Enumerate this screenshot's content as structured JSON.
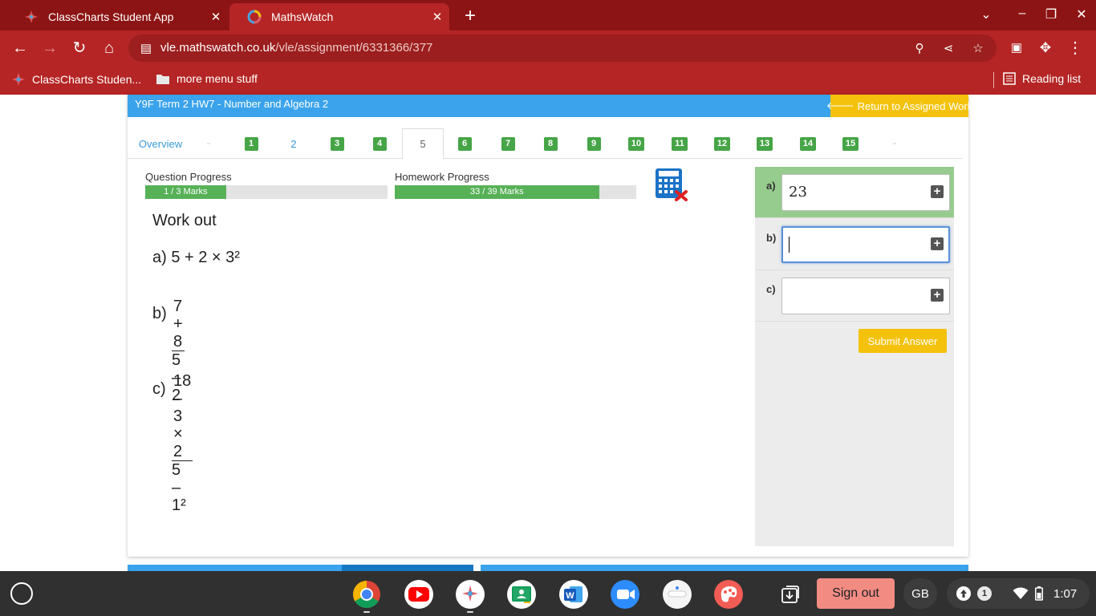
{
  "browser": {
    "tabs": [
      {
        "title": "ClassCharts Student App",
        "active": false
      },
      {
        "title": "MathsWatch",
        "active": true
      }
    ],
    "url": {
      "host": "vle.mathswatch.co.uk",
      "path": "/vle/assignment/6331366/377"
    },
    "bookmarks": [
      {
        "label": "ClassCharts Studen..."
      },
      {
        "label": "more menu stuff"
      }
    ],
    "reading_list": "Reading list"
  },
  "homework": {
    "title": "Y9F Term 2 HW7 - Number and Algebra 2",
    "return_label": "Return to Assigned Work",
    "tabs": [
      {
        "label": "Overview",
        "style": "link"
      },
      {
        "label": "1",
        "style": "chip"
      },
      {
        "label": "2",
        "style": "link"
      },
      {
        "label": "3",
        "style": "chip"
      },
      {
        "label": "4",
        "style": "chip"
      },
      {
        "label": "5",
        "style": "current"
      },
      {
        "label": "6",
        "style": "chip"
      },
      {
        "label": "7",
        "style": "chip"
      },
      {
        "label": "8",
        "style": "chip"
      },
      {
        "label": "9",
        "style": "chip"
      },
      {
        "label": "10",
        "style": "chip"
      },
      {
        "label": "11",
        "style": "chip"
      },
      {
        "label": "12",
        "style": "chip"
      },
      {
        "label": "13",
        "style": "chip"
      },
      {
        "label": "14",
        "style": "chip"
      },
      {
        "label": "15",
        "style": "chip"
      }
    ],
    "question_progress": {
      "label": "Question Progress",
      "text": "1 / 3 Marks",
      "fraction": 0.333
    },
    "homework_progress": {
      "label": "Homework Progress",
      "text": "33 / 39 Marks",
      "fraction": 0.846
    },
    "calculator": "calculator-not-allowed"
  },
  "question": {
    "heading": "Work out",
    "a": "a) 5 + 2 × 3²",
    "b": {
      "prefix": "b)",
      "numerator": "7 + 8",
      "denominator": "5 – 2"
    },
    "c": {
      "prefix": "c)",
      "numerator": "18 – 3 × 2",
      "denominator": "5 – 1²"
    }
  },
  "answers": [
    {
      "label": "a)",
      "value": "23",
      "status": "correct"
    },
    {
      "label": "b)",
      "value": "",
      "status": "focused"
    },
    {
      "label": "c)",
      "value": "",
      "status": "empty"
    }
  ],
  "submit_label": "Submit Answer",
  "shelf": {
    "signout": "Sign out",
    "ime": "GB",
    "notifications": "1",
    "time": "1:07"
  },
  "colors": {
    "tabbar": "#8d1414",
    "toolbar": "#b52525",
    "header_blue": "#3aa3ec",
    "accent_yellow": "#f4c20d",
    "chip_green": "#46a546",
    "correct_green": "#96cc8d"
  }
}
